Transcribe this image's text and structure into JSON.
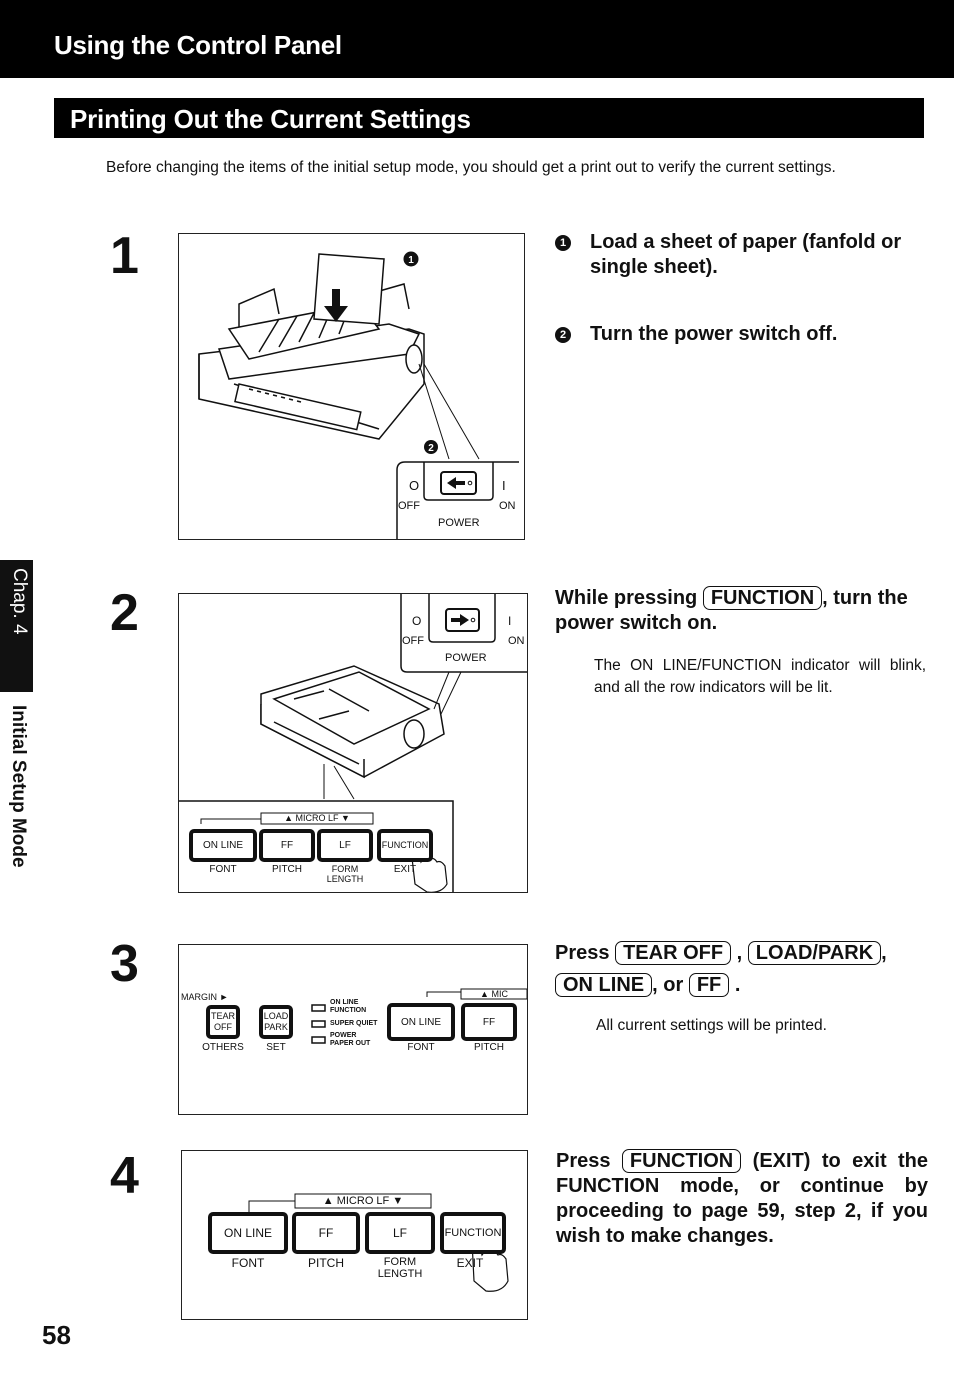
{
  "header": {
    "title": "Using the Control Panel"
  },
  "section": {
    "title": "Printing Out the Current Settings"
  },
  "intro": "Before changing the items of the initial setup mode, you should get a print out to verify the current settings.",
  "side_tab": {
    "chapter": "Chap. 4",
    "label": "Initial Setup Mode"
  },
  "page_number": "58",
  "steps": [
    {
      "number": "1",
      "items": [
        {
          "bullet": "1",
          "text": "Load a sheet of paper (fanfold or single sheet)."
        },
        {
          "bullet": "2",
          "text": "Turn the power switch off."
        }
      ],
      "figure": {
        "callouts": [
          "1",
          "2"
        ],
        "power_switch": {
          "off_symbol": "O",
          "on_symbol": "I",
          "off_label": "OFF",
          "on_label": "ON",
          "caption": "POWER",
          "arrow": "left"
        }
      }
    },
    {
      "number": "2",
      "heading_pre": "While pressing",
      "heading_key": "FUNCTION",
      "heading_post": ", turn the power switch on.",
      "description": "The ON LINE/FUNCTION indicator will blink, and all the row indicators will be lit.",
      "figure": {
        "power_switch": {
          "off_symbol": "O",
          "on_symbol": "I",
          "off_label": "OFF",
          "on_label": "ON",
          "caption": "POWER",
          "arrow": "right"
        },
        "micro_lf": "▲ MICRO LF ▼",
        "buttons": [
          {
            "label": "ON LINE",
            "sub": "FONT"
          },
          {
            "label": "FF",
            "sub": "PITCH"
          },
          {
            "label": "LF",
            "sub": "FORM LENGTH"
          },
          {
            "label": "FUNCTION",
            "sub": "EXIT"
          }
        ]
      }
    },
    {
      "number": "3",
      "heading_pre": "Press",
      "keys": [
        "TEAR OFF",
        "LOAD/PARK",
        "ON LINE",
        "FF"
      ],
      "sep1": ",",
      "sep2": ",",
      "sep3": ", or",
      "end": ".",
      "description": "All current settings will be printed.",
      "figure": {
        "margin_label": "MARGIN ►",
        "micro_lf": "▲ MIC",
        "left_buttons": [
          {
            "line1": "TEAR",
            "line2": "OFF",
            "sub": "OTHERS"
          },
          {
            "line1": "LOAD",
            "line2": "PARK",
            "sub": "SET"
          }
        ],
        "indicators": [
          {
            "line1": "ON LINE",
            "line2": "FUNCTION"
          },
          {
            "line1": "SUPER QUIET",
            "line2": ""
          },
          {
            "line1": "POWER",
            "line2": "PAPER OUT"
          }
        ],
        "right_buttons": [
          {
            "label": "ON LINE",
            "sub": "FONT"
          },
          {
            "label": "FF",
            "sub": "PITCH"
          }
        ]
      }
    },
    {
      "number": "4",
      "heading_pre": "Press",
      "heading_key": "FUNCTION",
      "heading_post": "(EXIT) to exit the FUNCTION mode, or continue by proceeding to page 59, step 2, if you wish to make changes.",
      "figure": {
        "micro_lf": "▲ MICRO LF ▼",
        "buttons": [
          {
            "label": "ON LINE",
            "sub": "FONT"
          },
          {
            "label": "FF",
            "sub": "PITCH"
          },
          {
            "label": "LF",
            "sub": "FORM LENGTH"
          },
          {
            "label": "FUNCTION",
            "sub": "EXIT"
          }
        ]
      }
    }
  ]
}
